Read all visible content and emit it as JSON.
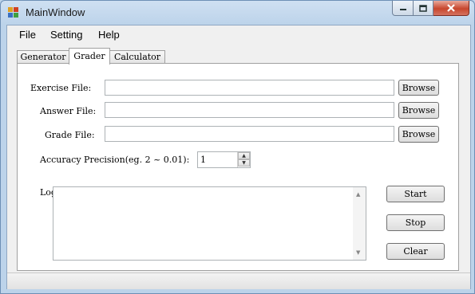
{
  "window": {
    "title": "MainWindow",
    "caption_buttons": {
      "minimize": "minimize-icon",
      "maximize": "maximize-icon",
      "close": "close-icon"
    }
  },
  "menu": [
    "File",
    "Setting",
    "Help"
  ],
  "tabs": {
    "items": [
      "Generator",
      "Grader",
      "Calculator"
    ],
    "active": "Grader"
  },
  "grader": {
    "exercise_label": "Exercise File:",
    "answer_label": "Answer File:",
    "grade_label": "Grade File:",
    "exercise_value": "",
    "answer_value": "",
    "grade_value": "",
    "browse_label": "Browse",
    "accuracy_label": "Accuracy Precision(eg. 2 ~ 0.01):",
    "accuracy_value": "1",
    "log_label": "Log",
    "log_value": "",
    "start_label": "Start",
    "stop_label": "Stop",
    "clear_label": "Clear"
  },
  "colors": {
    "title_bar": "#bcd3ea",
    "close_button": "#c7462d",
    "client_bg": "#f0f0f0"
  }
}
